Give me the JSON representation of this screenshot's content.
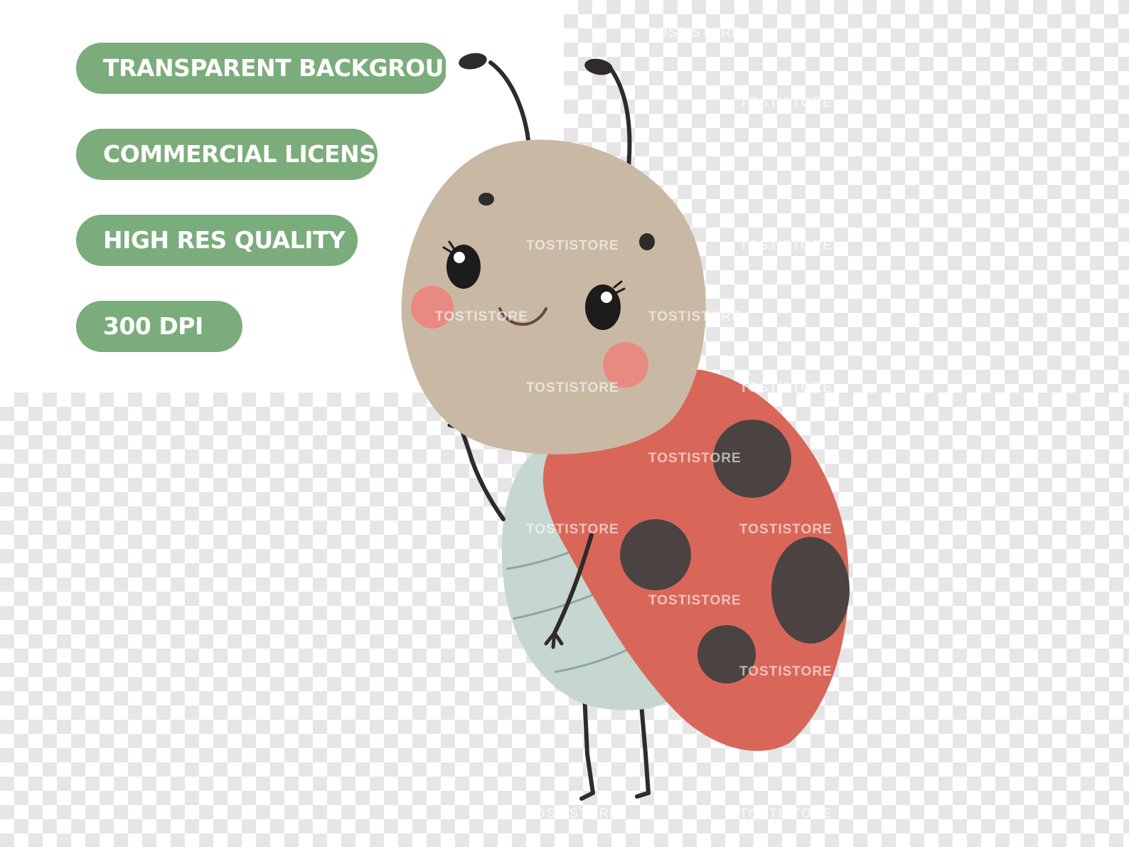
{
  "badges": [
    {
      "label": "TRANSPARENT BACKGROUND"
    },
    {
      "label": "COMMERCIAL LICENSE"
    },
    {
      "label": "HIGH RES QUALITY"
    },
    {
      "label": "300 DPI"
    }
  ],
  "watermark": "TOSTISTORE",
  "colors": {
    "badge_bg": "#7bac7b",
    "badge_text": "#ffffff",
    "head": "#c9b9a4",
    "shell": "#d8675a",
    "spots": "#4a4342",
    "belly": "#c6d6d0",
    "cheeks": "#e98a80"
  }
}
